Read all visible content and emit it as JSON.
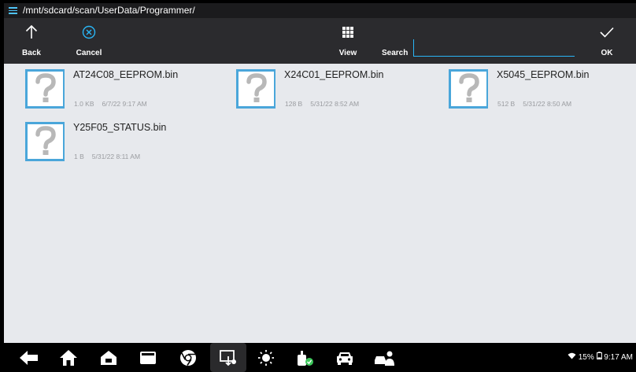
{
  "path_bar": {
    "path": "/mnt/sdcard/scan/UserData/Programmer/"
  },
  "toolbar": {
    "back_label": "Back",
    "cancel_label": "Cancel",
    "view_label": "View",
    "search_label": "Search",
    "search_value": "",
    "ok_label": "OK"
  },
  "files": [
    {
      "name": "AT24C08_EEPROM.bin",
      "size": "1.0 KB",
      "date": "6/7/22 9:17 AM"
    },
    {
      "name": "X24C01_EEPROM.bin",
      "size": "128 B",
      "date": "5/31/22 8:52 AM"
    },
    {
      "name": "X5045_EEPROM.bin",
      "size": "512 B",
      "date": "5/31/22 8:50 AM"
    },
    {
      "name": "Y25F05_STATUS.bin",
      "size": "1 B",
      "date": "5/31/22 8:11 AM"
    }
  ],
  "status_bar": {
    "battery": "15%",
    "time": "9:17 AM"
  },
  "colors": {
    "accent": "#29b6f6",
    "toolbar_bg": "#2b2b2e",
    "content_bg": "#e7e9ed"
  },
  "nav_icons": [
    "back-arrow-icon",
    "home-icon",
    "house-icon",
    "recent-apps-icon",
    "chrome-icon",
    "screenshot-icon",
    "brightness-icon",
    "vci-icon",
    "car-icon",
    "people-icon"
  ]
}
